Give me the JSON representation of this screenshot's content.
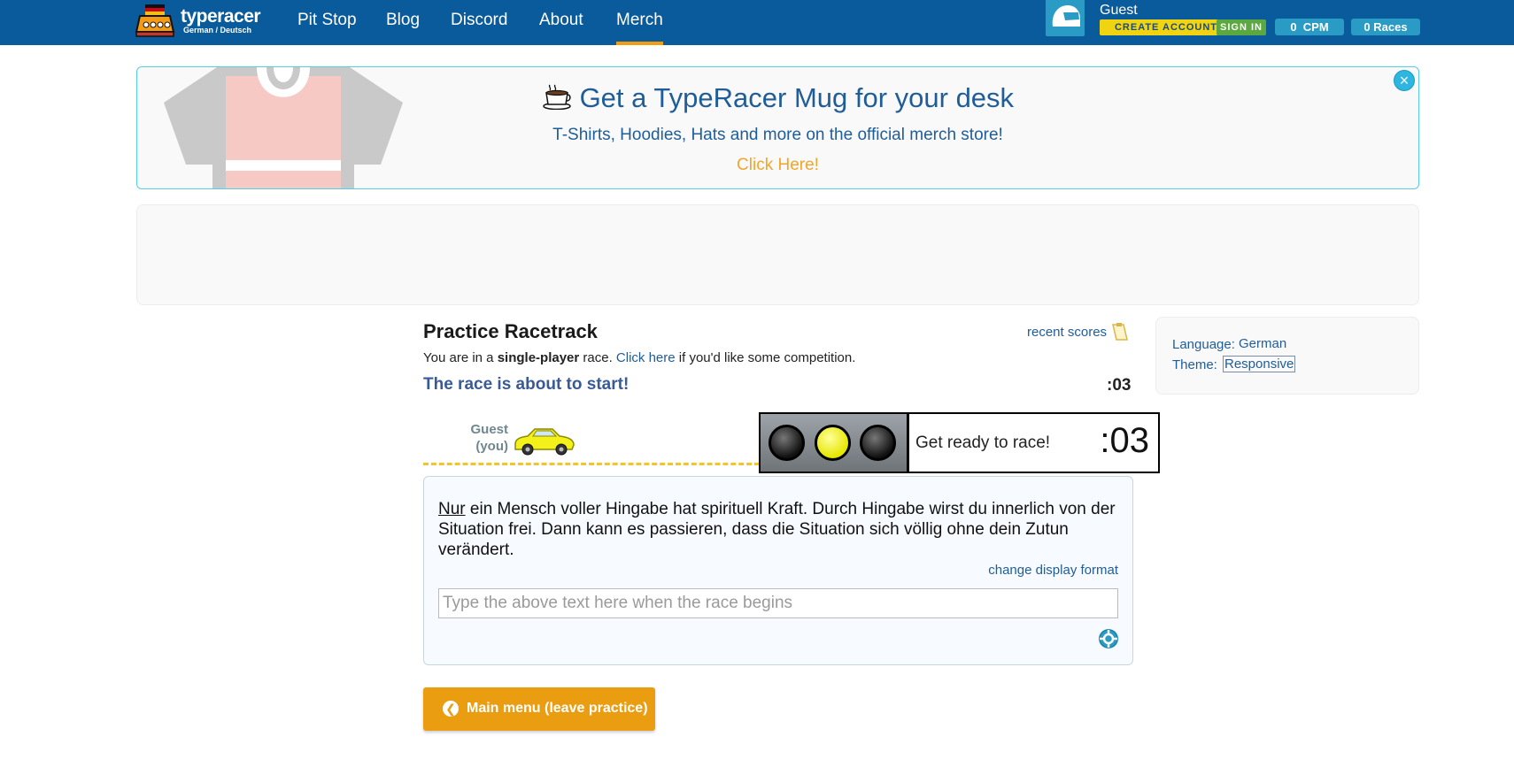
{
  "header": {
    "logo_title": "typeracer",
    "logo_subtitle": "German / Deutsch",
    "nav": [
      "Pit Stop",
      "Blog",
      "Discord",
      "About",
      "Merch"
    ],
    "active_nav": "Merch",
    "user": {
      "name": "Guest",
      "create_account": "CREATE ACCOUNT",
      "sign_in": "SIGN IN",
      "cpm_value": "0",
      "cpm_label": "CPM",
      "races": "0 Races"
    }
  },
  "banner": {
    "title": "Get a TypeRacer Mug for your desk",
    "subtitle": "T-Shirts, Hoodies, Hats and more on the official merch store!",
    "link": "Click Here!",
    "close": "×"
  },
  "race": {
    "title": "Practice Racetrack",
    "recent_scores": "recent scores",
    "single_prefix": "You are in a ",
    "single_bold": "single-player",
    "single_mid": " race. ",
    "single_link": "Click here",
    "single_suffix": " if you'd like some competition.",
    "status": "The race is about to start!",
    "countdown": ":03",
    "racer_name": "Guest",
    "racer_you": "(you)",
    "get_ready": "Get ready to race!",
    "big_countdown": ":03",
    "passage_first": "Nur",
    "passage_rest": " ein Mensch voller Hingabe hat spirituell Kraft. Durch Hingabe wirst du innerlich von der Situation frei. Dann kann es passieren, dass die Situation sich völlig ohne dein Zutun verändert.",
    "change_format": "change display format",
    "input_placeholder": "Type the above text here when the race begins",
    "main_menu": "Main menu (leave practice)"
  },
  "settings": {
    "language_label": "Language:",
    "language_value": "German",
    "theme_label": "Theme:",
    "theme_value": "Responsive"
  },
  "colors": {
    "header_bg": "#0a5b9b",
    "accent_orange": "#eb9d12",
    "brand_blue": "#1f5d99",
    "teal": "#2a9bc4"
  }
}
